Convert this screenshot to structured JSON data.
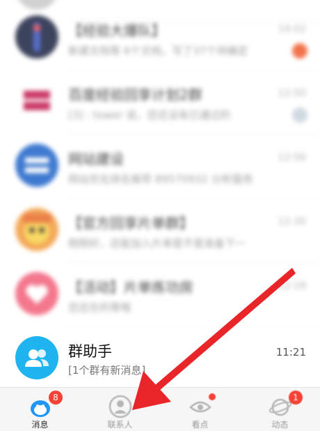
{
  "chats": [
    {
      "name": "【经验大爆队】",
      "preview": "新建文档等 6个文档，写了37个待确定",
      "time": "14:02",
      "badge": "dot"
    },
    {
      "name": "百度经验回享计划2群",
      "preview": "[3] : tower 说，您还没有已通过的",
      "time": "12:50",
      "badge": "muted"
    },
    {
      "name": "网站建设",
      "preview": "网站优化排名推荐 89570932 分析服务",
      "time": "12:56",
      "badge": ""
    },
    {
      "name": "【官方回享片单群】",
      "preview": "刚刚好，还能加入片单是不是准备下一",
      "time": "12:30",
      "badge": ""
    },
    {
      "name": "【活动】片单炼功房",
      "preview": "您还在的等哦",
      "time": "12:18",
      "badge": ""
    },
    {
      "name": "群助手",
      "preview": "[1个群有新消息]",
      "time": "11:21",
      "badge": ""
    }
  ],
  "tabs": [
    {
      "label": "消息",
      "badge": "8",
      "icon": "message-penguin-icon",
      "active": true
    },
    {
      "label": "联系人",
      "badge": "",
      "icon": "contacts-person-icon",
      "active": false
    },
    {
      "label": "看点",
      "badge": "dot",
      "icon": "eye-watch-icon",
      "active": false
    },
    {
      "label": "动态",
      "badge": "1",
      "icon": "planet-star-icon",
      "active": false
    }
  ],
  "colors": {
    "accent": "#2196f3",
    "badge": "#f44336",
    "annotation": "#e8262a"
  }
}
